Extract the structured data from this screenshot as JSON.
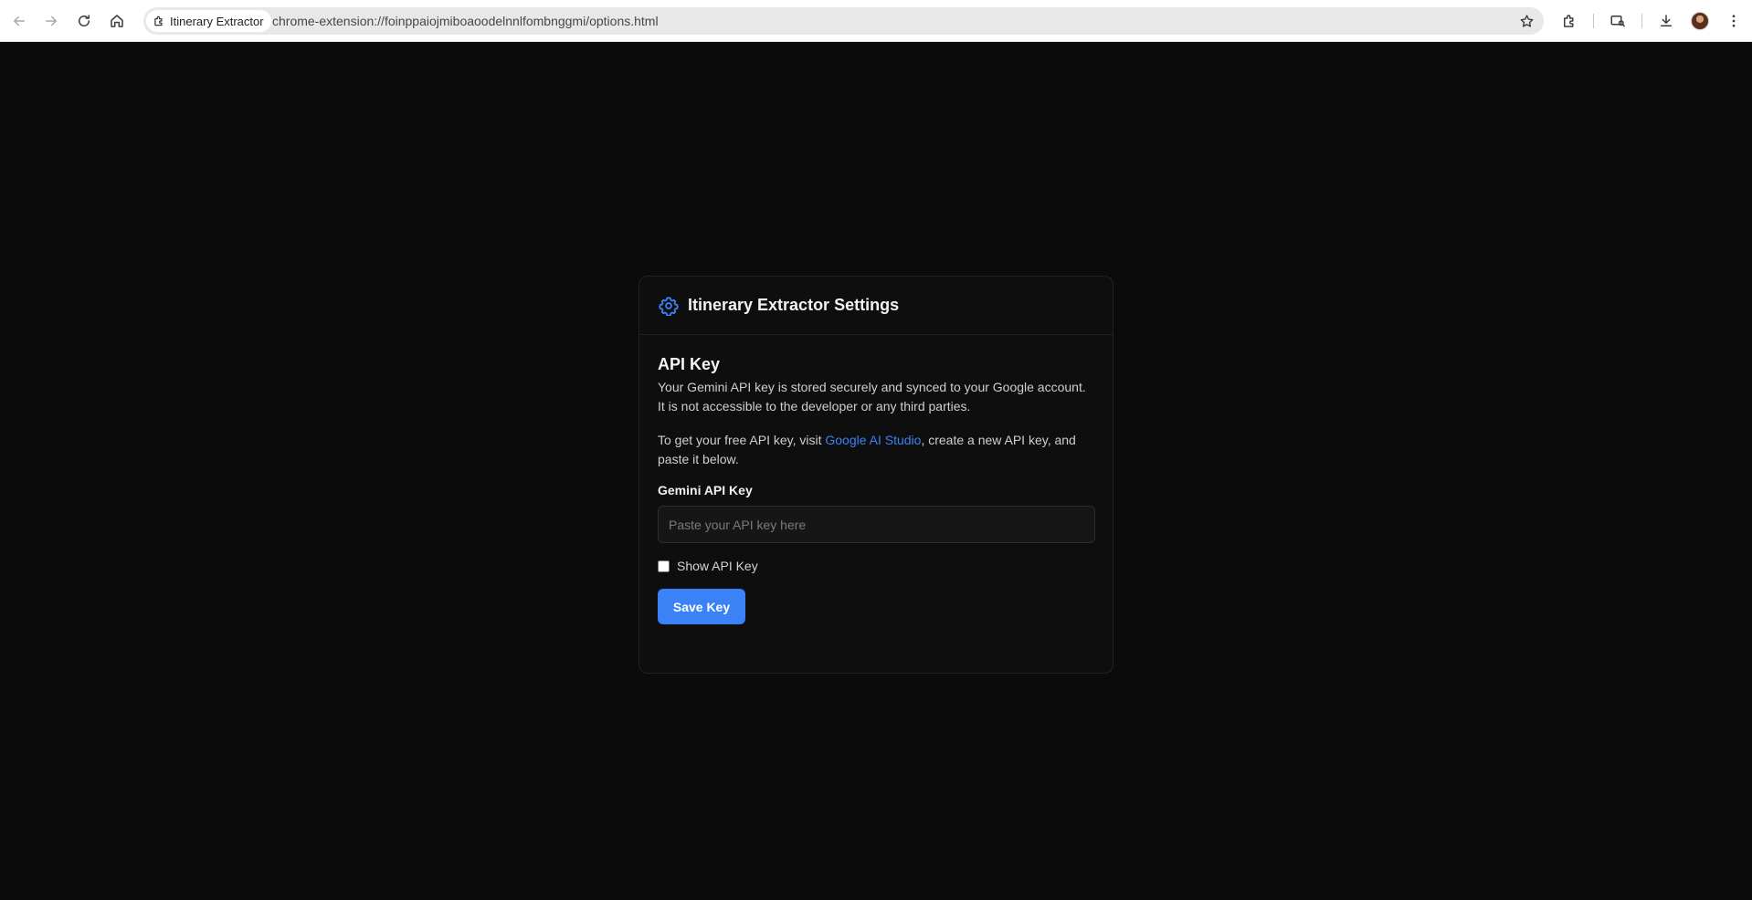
{
  "browser": {
    "tab_chip_label": "Itinerary Extractor",
    "url": "chrome-extension://foinppaiojmiboaoodelnnlfombnggmi/options.html",
    "icons": {
      "back": "arrow-left-icon",
      "forward": "arrow-right-icon",
      "reload": "reload-icon",
      "home": "home-icon",
      "site": "extension-icon",
      "bookmark": "star-icon",
      "extensions": "puzzle-icon",
      "tab_search": "tab-search-icon",
      "downloads": "download-icon",
      "menu": "kebab-menu-icon"
    }
  },
  "settings": {
    "header_icon": "gear-icon",
    "title": "Itinerary Extractor Settings",
    "section_title": "API Key",
    "description": "Your Gemini API key is stored securely and synced to your Google account. It is not accessible to the developer or any third parties.",
    "instructions": {
      "before_link": "To get your free API key, visit ",
      "link_text": "Google AI Studio",
      "after_link": ", create a new API key, and paste it below."
    },
    "field_label": "Gemini API Key",
    "input": {
      "value": "",
      "placeholder": "Paste your API key here"
    },
    "show_key": {
      "label": "Show API Key",
      "checked": false
    },
    "save_button": "Save Key"
  },
  "colors": {
    "page_background": "#0b0b0b",
    "card_background": "#0e0e0e",
    "accent": "#3b82f6"
  }
}
